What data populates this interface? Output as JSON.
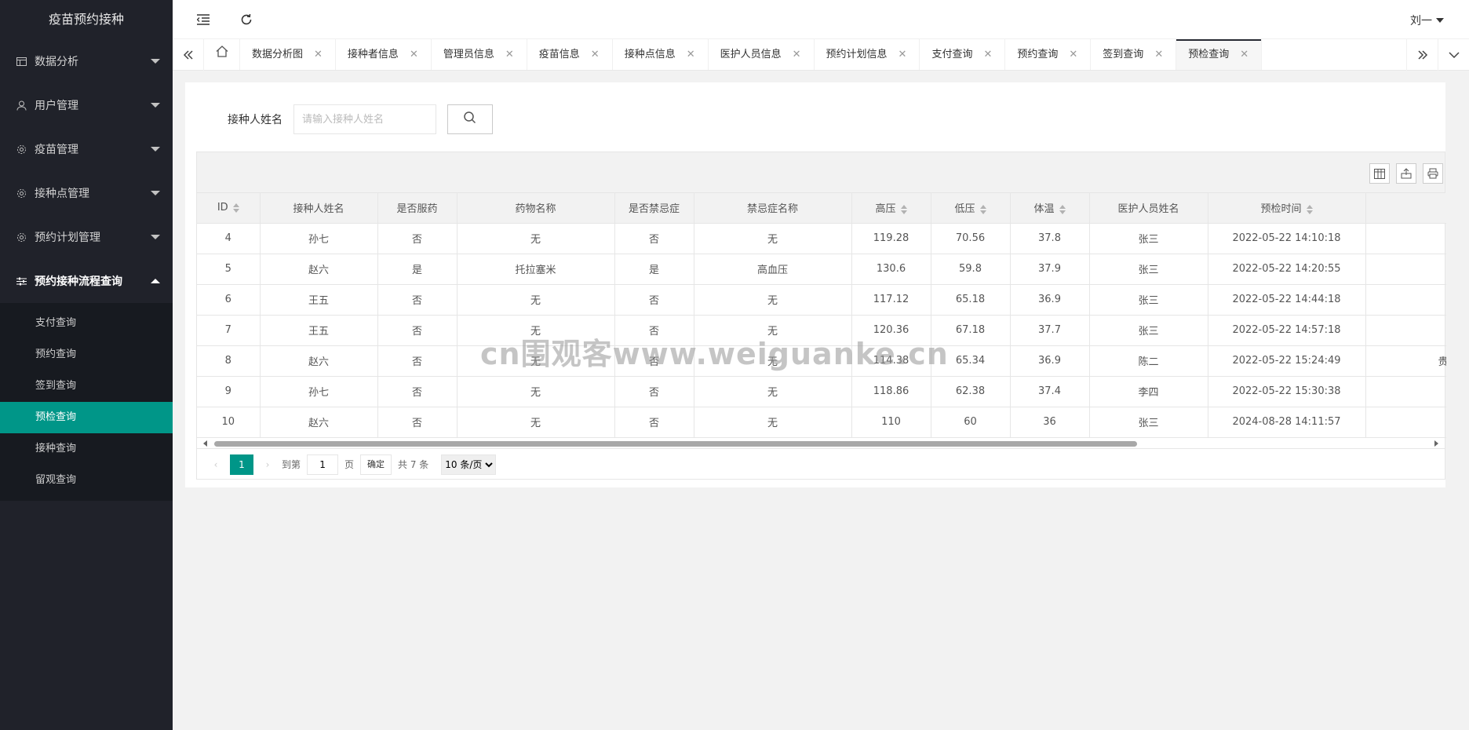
{
  "app": {
    "title": "疫苗预约接种"
  },
  "header": {
    "user": "刘一"
  },
  "sidebar": {
    "items": [
      {
        "label": "数据分析",
        "icon": "table-icon"
      },
      {
        "label": "用户管理",
        "icon": "user-icon"
      },
      {
        "label": "疫苗管理",
        "icon": "gear-icon"
      },
      {
        "label": "接种点管理",
        "icon": "gear-icon"
      },
      {
        "label": "预约计划管理",
        "icon": "gear-icon"
      },
      {
        "label": "预约接种流程查询",
        "icon": "sliders-icon"
      }
    ],
    "subitems": [
      "支付查询",
      "预约查询",
      "签到查询",
      "预检查询",
      "接种查询",
      "留观查询"
    ],
    "active_subitem": "预检查询"
  },
  "tabs": [
    "数据分析图",
    "接种者信息",
    "管理员信息",
    "疫苗信息",
    "接种点信息",
    "医护人员信息",
    "预约计划信息",
    "支付查询",
    "预约查询",
    "签到查询",
    "预检查询"
  ],
  "search": {
    "label": "接种人姓名",
    "placeholder": "请输入接种人姓名"
  },
  "table": {
    "columns": [
      "ID",
      "接种人姓名",
      "是否服药",
      "药物名称",
      "是否禁忌症",
      "禁忌症名称",
      "高压",
      "低压",
      "体温",
      "医护人员姓名",
      "预检时间",
      ""
    ],
    "rows": [
      [
        "4",
        "孙七",
        "否",
        "无",
        "否",
        "无",
        "119.28",
        "70.56",
        "37.8",
        "张三",
        "2022-05-22 14:10:18",
        ""
      ],
      [
        "5",
        "赵六",
        "是",
        "托拉塞米",
        "是",
        "高血压",
        "130.6",
        "59.8",
        "37.9",
        "张三",
        "2022-05-22 14:20:55",
        ""
      ],
      [
        "6",
        "王五",
        "否",
        "无",
        "否",
        "无",
        "117.12",
        "65.18",
        "36.9",
        "张三",
        "2022-05-22 14:44:18",
        ""
      ],
      [
        "7",
        "王五",
        "否",
        "无",
        "否",
        "无",
        "120.36",
        "67.18",
        "37.7",
        "张三",
        "2022-05-22 14:57:18",
        ""
      ],
      [
        "8",
        "赵六",
        "否",
        "无",
        "否",
        "无",
        "114.38",
        "65.34",
        "36.9",
        "陈二",
        "2022-05-22 15:24:49",
        "贵阳"
      ],
      [
        "9",
        "孙七",
        "否",
        "无",
        "否",
        "无",
        "118.86",
        "62.38",
        "37.4",
        "李四",
        "2022-05-22 15:30:38",
        ""
      ],
      [
        "10",
        "赵六",
        "否",
        "无",
        "否",
        "无",
        "110",
        "60",
        "36",
        "张三",
        "2024-08-28 14:11:57",
        ""
      ]
    ]
  },
  "pager": {
    "current": "1",
    "goto_label": "到第",
    "goto_value": "1",
    "page_unit": "页",
    "confirm": "确定",
    "total": "共 7 条",
    "page_size": "10 条/页"
  },
  "watermark": "cn围观客www.weiguanke.cn",
  "colors": {
    "sidebar": "#20222a",
    "accent": "#009688"
  }
}
